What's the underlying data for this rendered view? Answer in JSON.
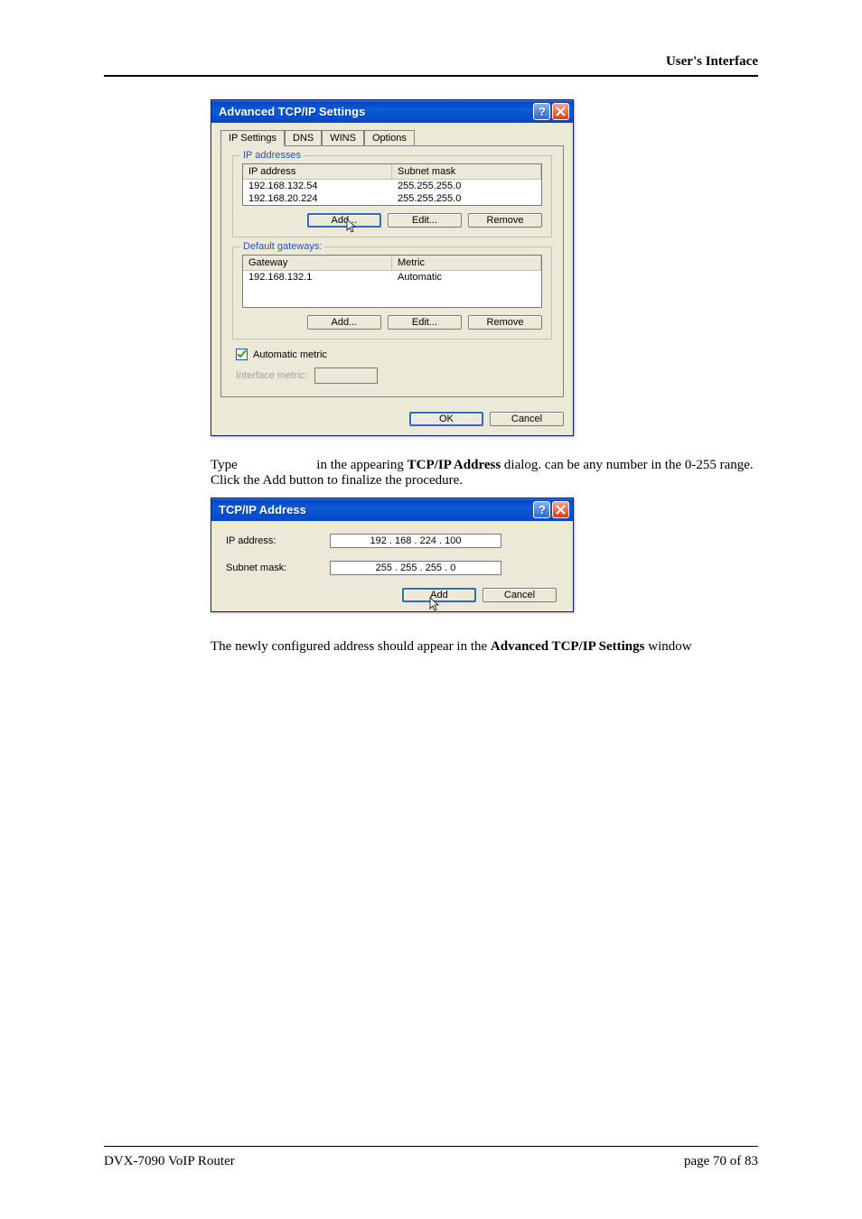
{
  "header": {
    "section": "User's Interface"
  },
  "dialog1": {
    "title": "Advanced TCP/IP Settings",
    "tabs": [
      "IP Settings",
      "DNS",
      "WINS",
      "Options"
    ],
    "active_tab": 0,
    "ip_group": {
      "title": "IP addresses",
      "columns": [
        "IP address",
        "Subnet mask"
      ],
      "rows": [
        {
          "ip": "192.168.132.54",
          "mask": "255.255.255.0"
        },
        {
          "ip": "192.168.20.224",
          "mask": "255.255.255.0"
        }
      ],
      "buttons": {
        "add": "Add...",
        "edit": "Edit...",
        "remove": "Remove"
      }
    },
    "gw_group": {
      "title": "Default gateways:",
      "columns": [
        "Gateway",
        "Metric"
      ],
      "rows": [
        {
          "gw": "192.168.132.1",
          "metric": "Automatic"
        }
      ],
      "buttons": {
        "add": "Add...",
        "edit": "Edit...",
        "remove": "Remove"
      }
    },
    "auto_metric_label": "Automatic metric",
    "auto_metric_checked": true,
    "interface_metric_label": "Interface metric:",
    "ok": "OK",
    "cancel": "Cancel"
  },
  "para1": {
    "prefix": "Type ",
    "mid1": " in the appearing ",
    "bold1": "TCP/IP Address",
    "mid2": " dialog.  ",
    "mid3": " can be any number in the 0-255 range. Click the Add button to finalize the procedure."
  },
  "dialog2": {
    "title": "TCP/IP Address",
    "ip_label": "IP address:",
    "ip_value": "192 . 168 . 224 . 100",
    "mask_label": "Subnet mask:",
    "mask_value": "255 . 255 . 255 .   0",
    "add": "Add",
    "cancel": "Cancel"
  },
  "para2": {
    "prefix": "The newly configured address should appear in the ",
    "bold": "Advanced TCP/IP Settings",
    "suffix": " window"
  },
  "footer": {
    "left": "DVX-7090 VoIP Router",
    "right": "page 70 of 83"
  }
}
